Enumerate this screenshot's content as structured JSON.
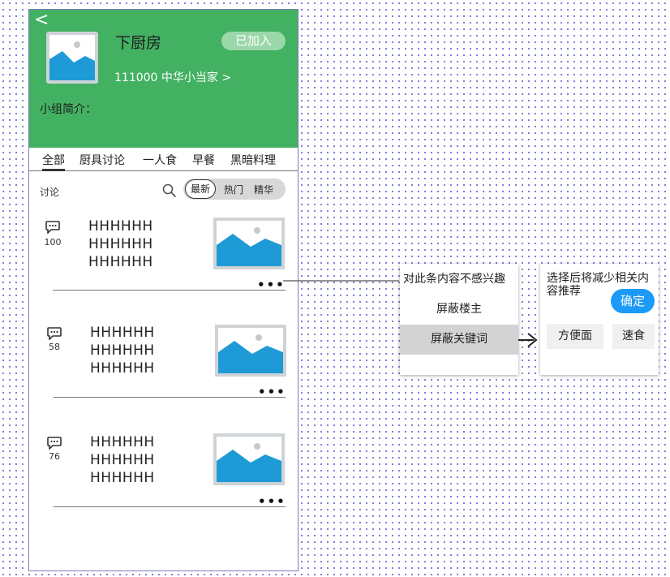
{
  "header": {
    "back": "<",
    "group_name": "下厨房",
    "joined_button": "已加入",
    "members": "111000  中华小当家 >",
    "intro_label": "小组简介："
  },
  "tabs": [
    "全部",
    "厨具讨论",
    "一人食",
    "早餐",
    "黑暗料理"
  ],
  "filter": {
    "label": "讨论",
    "sort_options": [
      "最新",
      "热门",
      "精华"
    ]
  },
  "posts": [
    {
      "count": "100",
      "lines": [
        "HHHHHH",
        "HHHHHH",
        "HHHHHH"
      ],
      "more": "•••"
    },
    {
      "count": "58",
      "lines": [
        "HHHHHH",
        "HHHHHH",
        "HHHHHH"
      ],
      "more": "•••"
    },
    {
      "count": "76",
      "lines": [
        "HHHHHH",
        "HHHHHH",
        "HHHHHH"
      ],
      "more": "•••"
    }
  ],
  "menu": {
    "title": "对此条内容不感兴趣",
    "items": [
      "屏蔽楼主",
      "屏蔽关键词"
    ]
  },
  "panel": {
    "text": "选择后将减少相关内容推荐",
    "confirm": "确定",
    "tags": [
      "方便面",
      "速食"
    ]
  },
  "colors": {
    "header_green": "#43b162",
    "confirm_blue": "#1b9af7",
    "image_blue": "#1e9ad6"
  }
}
